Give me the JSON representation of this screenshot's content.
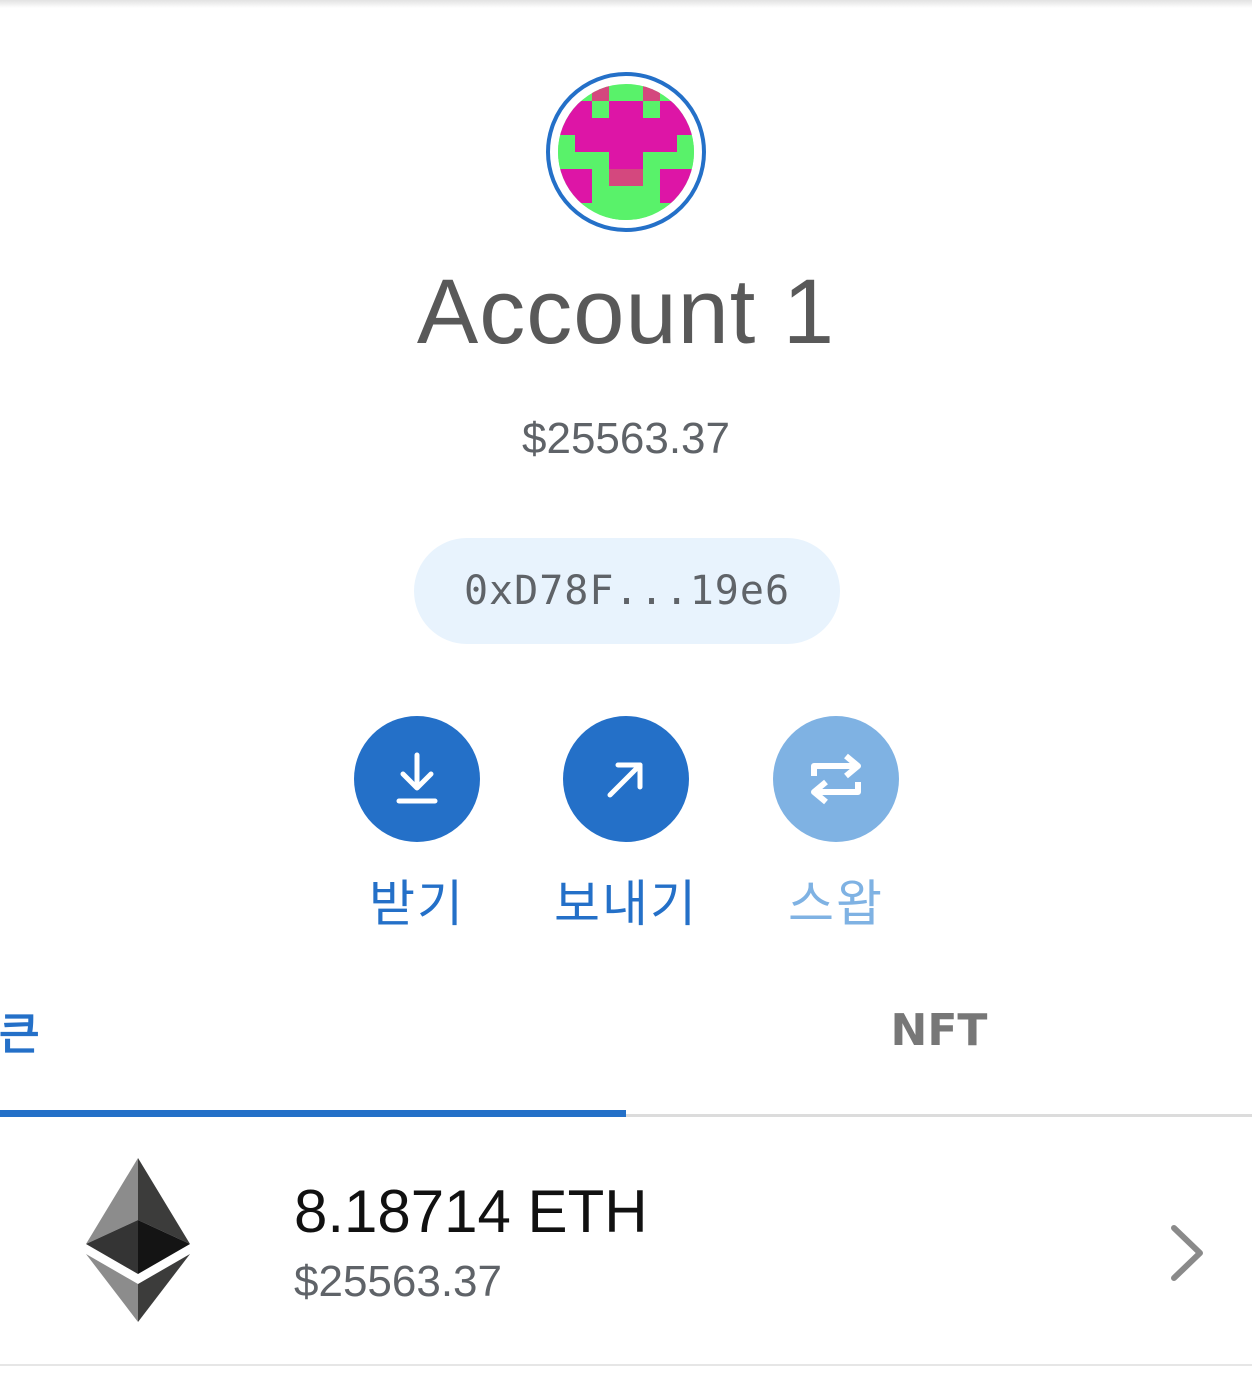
{
  "account": {
    "name": "Account 1",
    "balance": "$25563.37",
    "address_short": "0xD78F...19e6"
  },
  "actions": [
    {
      "label": "받기",
      "icon": "download-icon",
      "enabled": true
    },
    {
      "label": "보내기",
      "icon": "send-arrow-icon",
      "enabled": true
    },
    {
      "label": "스왑",
      "icon": "swap-icon",
      "enabled": false
    }
  ],
  "tabs": [
    {
      "label": "토큰",
      "active": true
    },
    {
      "label": "NFT",
      "active": false
    }
  ],
  "tokens": [
    {
      "amount": "8.18714 ETH",
      "fiat": "$25563.37",
      "icon": "ethereum-icon"
    }
  ],
  "colors": {
    "accent": "#2470c8",
    "accent_disabled": "#7fb2e3",
    "avatar_green": "#59f26a",
    "avatar_magenta": "#dd15a6",
    "avatar_pink": "#d4487e",
    "inactive_tab": "#777777",
    "address_pill_bg": "#e8f3fd"
  }
}
